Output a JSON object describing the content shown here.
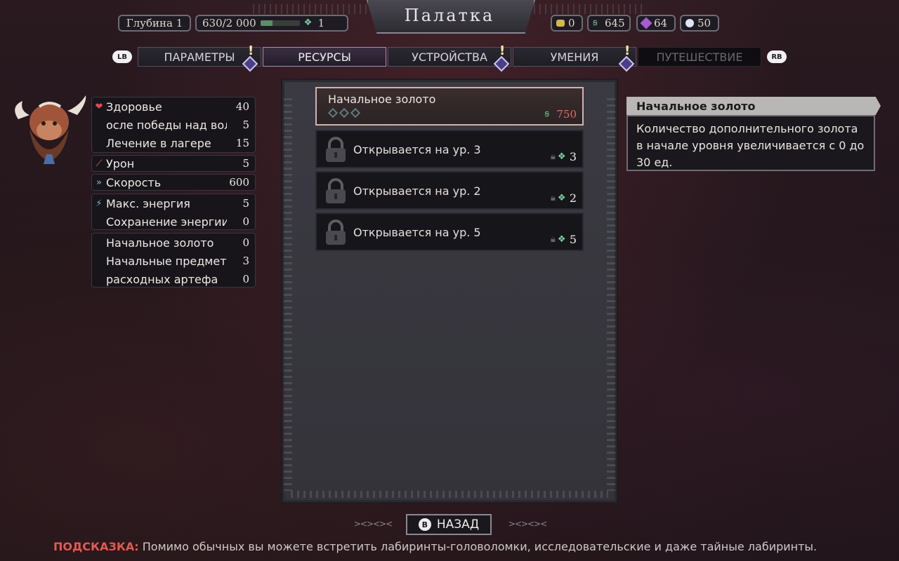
{
  "header": {
    "title": "Палатка",
    "depth_label": "Глубина",
    "depth_value": "1",
    "progress_text": "630/2 000",
    "progress_fraction": 0.315,
    "progress_rune_count": "1",
    "resources": [
      {
        "icon": "gold-nugget-icon",
        "value": "0"
      },
      {
        "icon": "rune-leaf-icon",
        "value": "645"
      },
      {
        "icon": "purple-gem-icon",
        "value": "64"
      },
      {
        "icon": "silver-orb-icon",
        "value": "50"
      }
    ]
  },
  "tabs": {
    "left_bumper": "LB",
    "right_bumper": "RB",
    "items": [
      {
        "label": "ПАРАМЕТРЫ",
        "state": "normal",
        "alert": "!"
      },
      {
        "label": "РЕСУРСЫ",
        "state": "active"
      },
      {
        "label": "УСТРОЙСТВА",
        "state": "normal",
        "alert": "!"
      },
      {
        "label": "УМЕНИЯ",
        "state": "normal",
        "alert": "!"
      },
      {
        "label": "ПУТЕШЕСТВИЕ",
        "state": "disabled"
      }
    ]
  },
  "stats": {
    "health": {
      "label": "Здоровье",
      "value": "40"
    },
    "after_wolf": {
      "label": "осле победы над вол",
      "value": "5"
    },
    "camp_heal": {
      "label": "Лечение в лагере",
      "value": "15"
    },
    "damage": {
      "label": "Урон",
      "value": "5"
    },
    "speed": {
      "label": "Скорость",
      "value": "600"
    },
    "max_energy": {
      "label": "Макс. энергия",
      "value": "5"
    },
    "save_energy": {
      "label": "Сохранение энергии",
      "value": "0"
    },
    "start_gold": {
      "label": "Начальное золото",
      "value": "0"
    },
    "start_items": {
      "label": "Начальные предметь",
      "value": "3"
    },
    "consumables": {
      "label": "расходных артефа",
      "value": "0"
    }
  },
  "upgrades": {
    "selected": {
      "title": "Начальное золото",
      "tiers_total": 3,
      "cost": "750"
    },
    "locked": [
      {
        "text": "Открывается на ур. 3",
        "required": "3"
      },
      {
        "text": "Открывается на ур. 2",
        "required": "2"
      },
      {
        "text": "Открывается на ур. 5",
        "required": "5"
      }
    ]
  },
  "tooltip": {
    "title": "Начальное золото",
    "body": "Количество дополнительного золота в начале уровня увеличивается с 0 до 30 ед."
  },
  "footer": {
    "back_button_key": "B",
    "back_button_label": "НАЗАД",
    "hint_label": "ПОДСКАЗКА:",
    "hint_text": " Помимо обычных вы можете встретить лабиринты-головоломки, исследовательские и даже тайные лабиринты."
  },
  "colors": {
    "accent_purple": "#4c3e88",
    "cost_red": "#e06a6a",
    "hint_red": "#e05a52",
    "progress_green": "#5f8c6a"
  }
}
